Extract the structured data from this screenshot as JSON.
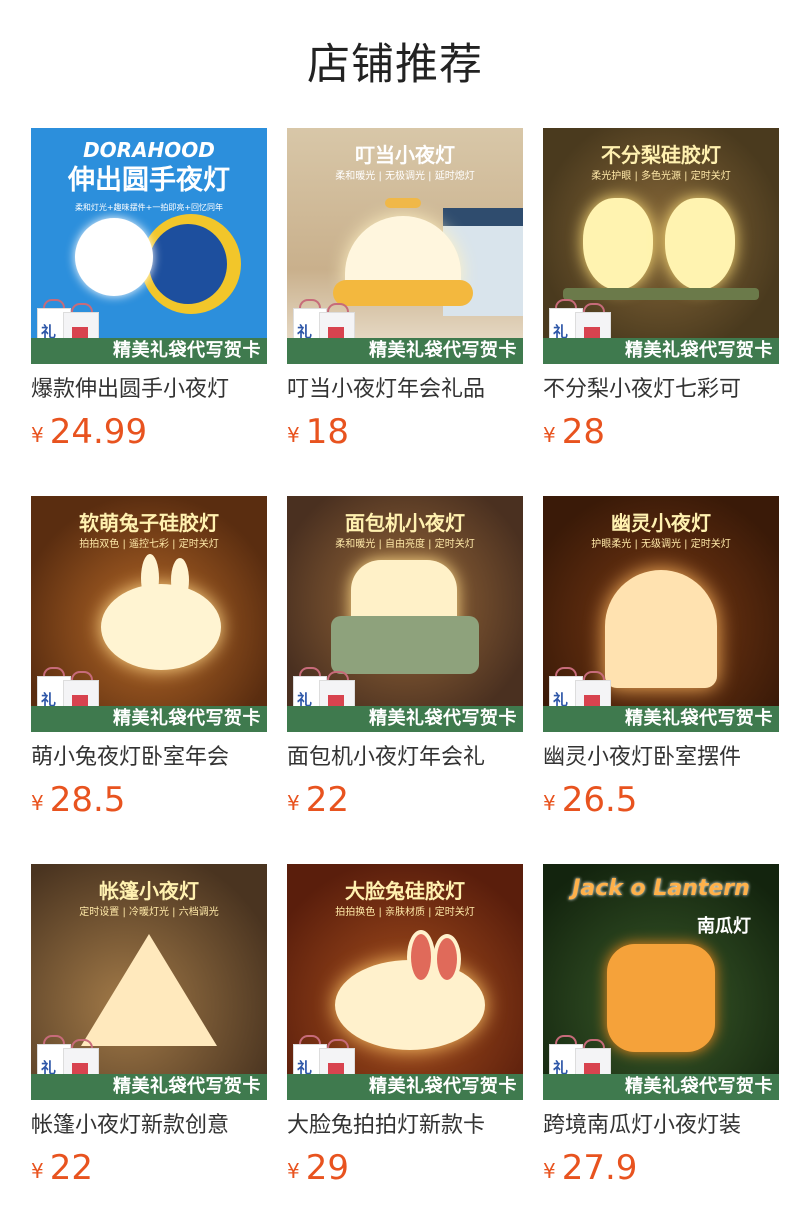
{
  "page_title": "店铺推荐",
  "badge_text": "精美礼袋代写贺卡",
  "bag_text": "礼物",
  "currency": "¥",
  "products": [
    {
      "name": "爆款伸出圆手小夜灯",
      "price": "24.99",
      "poster_title": "伸出圆手夜灯",
      "poster_sub": "柔和灯光+趣味摆件+一拍即亮+回忆同年",
      "brand": "DORAHOOD",
      "theme": "blue"
    },
    {
      "name": "叮当小夜灯年会礼品",
      "price": "18",
      "poster_title": "叮当小夜灯",
      "poster_sub": "柔和暖光 | 无极调光 | 延时熄灯",
      "theme": "bell"
    },
    {
      "name": "不分梨小夜灯七彩可",
      "price": "28",
      "poster_title": "不分梨硅胶灯",
      "poster_sub": "柔光护眼 | 多色光源 | 定时关灯",
      "theme": "pear"
    },
    {
      "name": "萌小兔夜灯卧室年会",
      "price": "28.5",
      "poster_title": "软萌兔子硅胶灯",
      "poster_sub": "拍拍双色 | 遥控七彩 | 定时关灯",
      "theme": "rabbit"
    },
    {
      "name": "面包机小夜灯年会礼",
      "price": "22",
      "poster_title": "面包机小夜灯",
      "poster_sub": "柔和暖光 | 自由亮度 | 定时关灯",
      "theme": "toast"
    },
    {
      "name": "幽灵小夜灯卧室摆件",
      "price": "26.5",
      "poster_title": "幽灵小夜灯",
      "poster_sub": "护眼柔光 | 无级调光 | 定时关灯",
      "theme": "ghost"
    },
    {
      "name": "帐篷小夜灯新款创意",
      "price": "22",
      "poster_title": "帐篷小夜灯",
      "poster_sub": "定时设置 | 冷暖灯光 | 六档调光",
      "theme": "tent"
    },
    {
      "name": "大脸兔拍拍灯新款卡",
      "price": "29",
      "poster_title": "大脸兔硅胶灯",
      "poster_sub": "拍拍换色 | 亲肤材质 | 定时关灯",
      "theme": "bigrabbit"
    },
    {
      "name": "跨境南瓜灯小夜灯装",
      "price": "27.9",
      "poster_title": "Jack o Lantern",
      "poster_sub": "南瓜灯",
      "theme": "pumpkin"
    }
  ]
}
